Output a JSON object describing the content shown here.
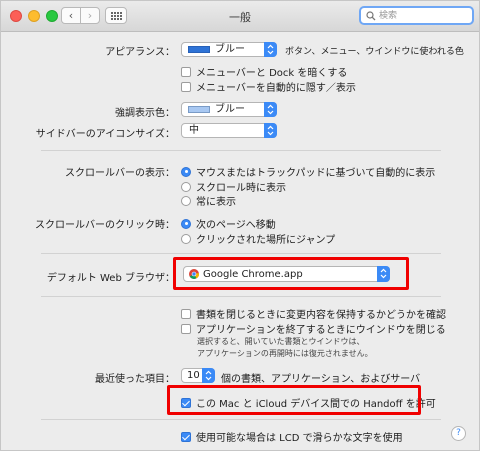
{
  "window": {
    "title": "一般",
    "search_placeholder": "検索"
  },
  "appearance": {
    "label": "アピアランス：",
    "value": "ブルー",
    "hint": "ボタン、メニュー、ウインドウに使われる色",
    "dark_menu": "メニューバーと Dock を暗くする",
    "auto_hide": "メニューバーを自動的に隠す／表示"
  },
  "highlight": {
    "label": "強調表示色：",
    "value": "ブルー"
  },
  "sidebar_icon": {
    "label": "サイドバーのアイコンサイズ：",
    "value": "中"
  },
  "scrollbars": {
    "label": "スクロールバーの表示：",
    "options": [
      "マウスまたはトラックパッドに基づいて自動的に表示",
      "スクロール時に表示",
      "常に表示"
    ]
  },
  "scroll_click": {
    "label": "スクロールバーのクリック時：",
    "options": [
      "次のページへ移動",
      "クリックされた場所にジャンプ"
    ]
  },
  "browser": {
    "label": "デフォルト Web ブラウザ：",
    "value": "Google Chrome.app"
  },
  "documents": {
    "ask_keep": "書類を閉じるときに変更内容を保持するかどうかを確認",
    "close_windows": "アプリケーションを終了するときにウインドウを閉じる",
    "note_line1": "選択すると、開いていた書類とウインドウは、",
    "note_line2": "アプリケーションの再開時には復元されません。"
  },
  "recent": {
    "label": "最近使った項目：",
    "value": "10",
    "suffix": "個の書類、アプリケーション、およびサーバ"
  },
  "handoff": {
    "label": "この Mac と iCloud デバイス間での Handoff を許可"
  },
  "lcd": {
    "label": "使用可能な場合は LCD で滑らかな文字を使用"
  },
  "colors": {
    "accent": "#3b8af6",
    "highlight_box": "#f00000"
  }
}
